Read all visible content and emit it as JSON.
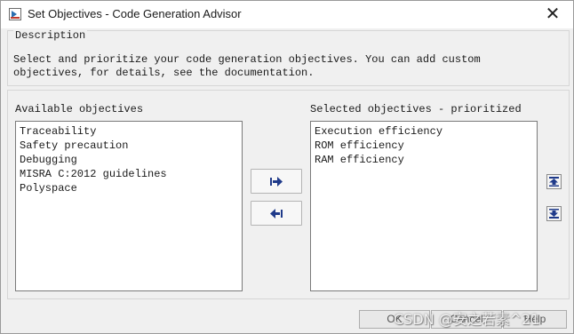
{
  "window": {
    "title": "Set Objectives - Code Generation Advisor",
    "close_glyph": "✕"
  },
  "description": {
    "group_label": "Description",
    "line1": "Select and prioritize your code generation objectives. You can add custom",
    "line2": "objectives, for details, see the documentation."
  },
  "available": {
    "label": "Available objectives",
    "items": [
      "Traceability",
      "Safety precaution",
      "Debugging",
      "MISRA C:2012 guidelines",
      "Polyspace"
    ]
  },
  "selected": {
    "label": "Selected objectives - prioritized",
    "items": [
      "Execution efficiency",
      "ROM efficiency",
      "RAM efficiency"
    ]
  },
  "buttons": {
    "add_icon": "arrow-right-icon",
    "remove_icon": "arrow-left-icon",
    "up_icon": "move-to-top-icon",
    "down_icon": "move-to-bottom-icon",
    "ok": "OK",
    "cancel": "Cancel",
    "help": "Help"
  },
  "watermark": "CSDN @安之若素^21",
  "colors": {
    "arrow": "#1f3a8a",
    "title_bar": "#ffffff",
    "dialog_bg": "#f0f0f0"
  }
}
